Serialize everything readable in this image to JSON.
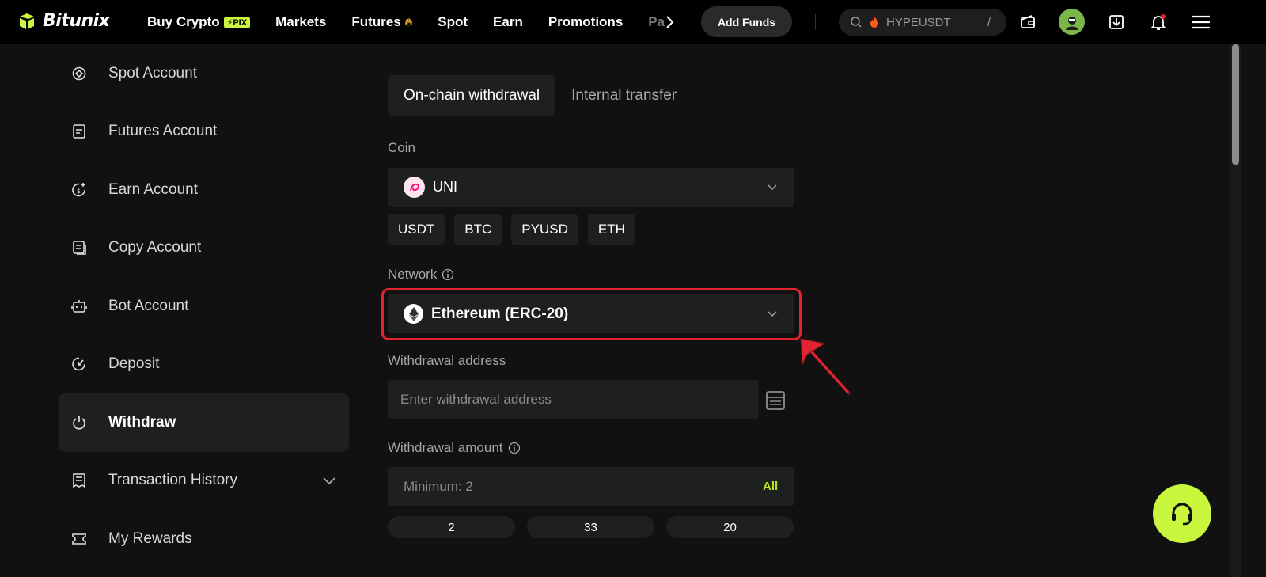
{
  "brand": {
    "name": "Bitunix",
    "accent": "#c8f73d"
  },
  "nav": {
    "buy_crypto": "Buy Crypto",
    "pix_badge": "⚡PIX",
    "markets": "Markets",
    "futures": "Futures",
    "spot": "Spot",
    "earn": "Earn",
    "promotions": "Promotions",
    "more": "Pa",
    "add_funds": "Add Funds",
    "search_text": "HYPEUSDT",
    "search_shortcut": "/"
  },
  "sidebar": {
    "items": [
      {
        "label": "Spot Account",
        "icon": "target-icon"
      },
      {
        "label": "Futures Account",
        "icon": "document-icon"
      },
      {
        "label": "Earn Account",
        "icon": "coin-plus-icon"
      },
      {
        "label": "Copy Account",
        "icon": "copy-doc-icon"
      },
      {
        "label": "Bot Account",
        "icon": "bot-icon"
      },
      {
        "label": "Deposit",
        "icon": "deposit-icon"
      },
      {
        "label": "Withdraw",
        "icon": "power-icon",
        "active": true
      },
      {
        "label": "Transaction History",
        "icon": "receipt-icon"
      },
      {
        "label": "My Rewards",
        "icon": "reward-icon"
      }
    ]
  },
  "tabs": {
    "onchain": "On-chain withdrawal",
    "internal": "Internal transfer"
  },
  "form": {
    "coin_label": "Coin",
    "coin_value": "UNI",
    "coin_chips": [
      "USDT",
      "BTC",
      "PYUSD",
      "ETH"
    ],
    "network_label": "Network",
    "network_value": "Ethereum (ERC-20)",
    "address_label": "Withdrawal address",
    "address_placeholder": "Enter withdrawal address",
    "amount_label": "Withdrawal amount",
    "amount_placeholder": "Minimum: 2",
    "all_label": "All",
    "quick_values": [
      "2",
      "33",
      "20"
    ]
  },
  "annotation": {
    "highlight_color": "#e3232f"
  }
}
